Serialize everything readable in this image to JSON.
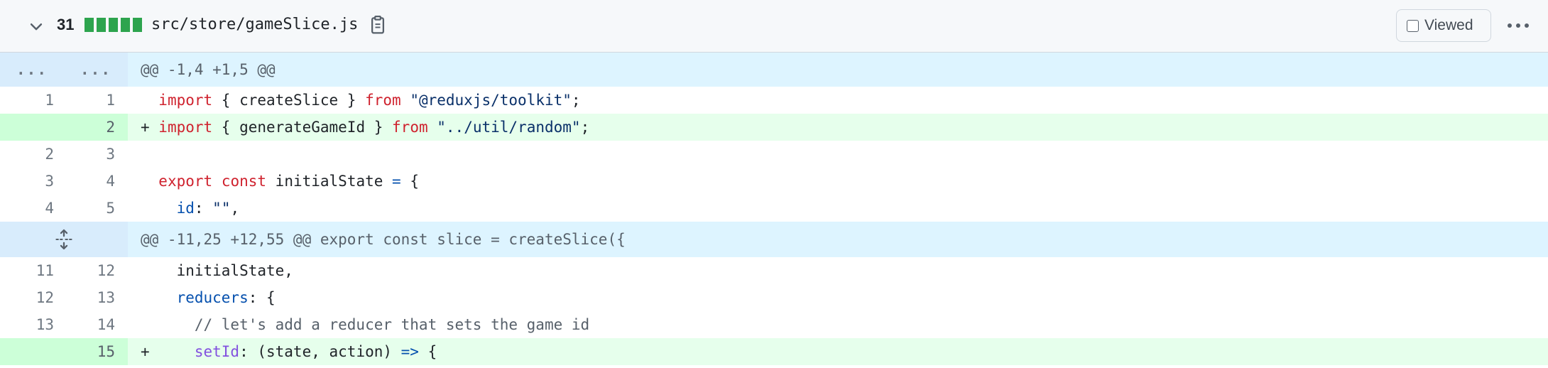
{
  "file": {
    "change_count": "31",
    "path": "src/store/gameSlice.js",
    "viewed_label": "Viewed",
    "diffstat_color": "#2da44e"
  },
  "hunks": [
    {
      "header": "@@ -1,4 +1,5 @@",
      "old_marker": "...",
      "new_marker": "...",
      "lines": [
        {
          "old": "1",
          "new": "1",
          "type": "context",
          "tokens": [
            [
              "",
              "  "
            ],
            [
              "kw",
              "import"
            ],
            [
              "",
              " { createSlice } "
            ],
            [
              "kw",
              "from"
            ],
            [
              "",
              " "
            ],
            [
              "str",
              "\"@reduxjs/toolkit\""
            ],
            [
              "",
              ";"
            ]
          ]
        },
        {
          "old": "",
          "new": "2",
          "type": "add",
          "tokens": [
            [
              "",
              "+ "
            ],
            [
              "kw",
              "import"
            ],
            [
              "",
              " { generateGameId } "
            ],
            [
              "kw",
              "from"
            ],
            [
              "",
              " "
            ],
            [
              "str",
              "\"../util/random\""
            ],
            [
              "",
              ";"
            ]
          ]
        },
        {
          "old": "2",
          "new": "3",
          "type": "context",
          "tokens": [
            [
              "",
              " "
            ]
          ]
        },
        {
          "old": "3",
          "new": "4",
          "type": "context",
          "tokens": [
            [
              "",
              "  "
            ],
            [
              "kw",
              "export"
            ],
            [
              "",
              " "
            ],
            [
              "kw",
              "const"
            ],
            [
              "",
              " initialState "
            ],
            [
              "op",
              "="
            ],
            [
              "",
              " {"
            ]
          ]
        },
        {
          "old": "4",
          "new": "5",
          "type": "context",
          "tokens": [
            [
              "",
              "    "
            ],
            [
              "prop",
              "id"
            ],
            [
              "",
              ": "
            ],
            [
              "str",
              "\"\""
            ],
            [
              "",
              ","
            ]
          ]
        }
      ]
    },
    {
      "header": "@@ -11,25 +12,55 @@ export const slice = createSlice({",
      "lines": [
        {
          "old": "11",
          "new": "12",
          "type": "context",
          "tokens": [
            [
              "",
              "    initialState,"
            ]
          ]
        },
        {
          "old": "12",
          "new": "13",
          "type": "context",
          "tokens": [
            [
              "",
              "    "
            ],
            [
              "prop",
              "reducers"
            ],
            [
              "",
              ": {"
            ]
          ]
        },
        {
          "old": "13",
          "new": "14",
          "type": "context",
          "tokens": [
            [
              "",
              "      "
            ],
            [
              "cmt",
              "// let's add a reducer that sets the game id"
            ]
          ]
        },
        {
          "old": "",
          "new": "15",
          "type": "add",
          "tokens": [
            [
              "",
              "+     "
            ],
            [
              "fn",
              "setId"
            ],
            [
              "",
              ": (state, action) "
            ],
            [
              "op",
              "=>"
            ],
            [
              "",
              " {"
            ]
          ]
        }
      ]
    }
  ]
}
